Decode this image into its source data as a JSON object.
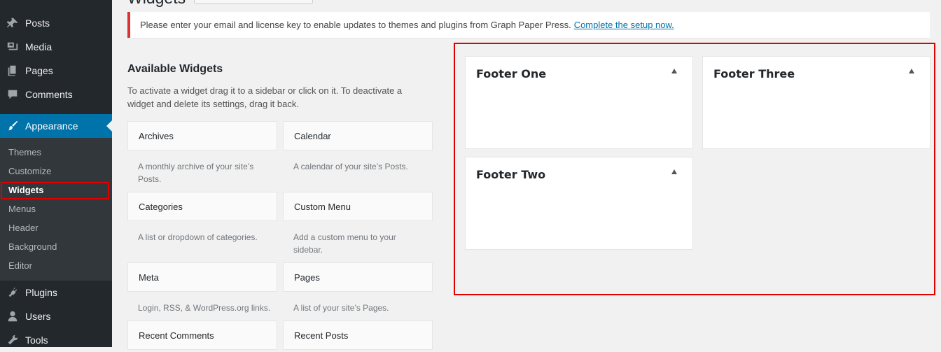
{
  "menu": {
    "items": [
      {
        "key": "posts",
        "label": "Posts",
        "icon": "pin-icon"
      },
      {
        "key": "media",
        "label": "Media",
        "icon": "media-icon"
      },
      {
        "key": "pages",
        "label": "Pages",
        "icon": "pages-icon"
      },
      {
        "key": "comments",
        "label": "Comments",
        "icon": "comment-icon"
      },
      {
        "key": "appearance",
        "label": "Appearance",
        "icon": "paintbrush-icon"
      },
      {
        "key": "plugins",
        "label": "Plugins",
        "icon": "plug-icon"
      },
      {
        "key": "users",
        "label": "Users",
        "icon": "user-icon"
      },
      {
        "key": "tools",
        "label": "Tools",
        "icon": "wrench-icon"
      }
    ],
    "submenu": [
      "Themes",
      "Customize",
      "Widgets",
      "Menus",
      "Header",
      "Background",
      "Editor"
    ],
    "current_sub": "Widgets"
  },
  "page": {
    "title": "Widgets"
  },
  "notice": {
    "text": "Please enter your email and license key to enable updates to themes and plugins from Graph Paper Press.",
    "link": "Complete the setup now."
  },
  "available": {
    "title": "Available Widgets",
    "description": "To activate a widget drag it to a sidebar or click on it. To deactivate a widget and delete its settings, drag it back.",
    "widgets": [
      {
        "name": "Archives",
        "desc": "A monthly archive of your site’s Posts."
      },
      {
        "name": "Calendar",
        "desc": "A calendar of your site’s Posts."
      },
      {
        "name": "Categories",
        "desc": "A list or dropdown of categories."
      },
      {
        "name": "Custom Menu",
        "desc": "Add a custom menu to your sidebar."
      },
      {
        "name": "Meta",
        "desc": "Login, RSS, & WordPress.org links."
      },
      {
        "name": "Pages",
        "desc": "A list of your site’s Pages."
      },
      {
        "name": "Recent Comments",
        "desc": ""
      },
      {
        "name": "Recent Posts",
        "desc": ""
      }
    ]
  },
  "sidebars": [
    {
      "title": "Footer One"
    },
    {
      "title": "Footer Three"
    },
    {
      "title": "Footer Two"
    }
  ],
  "colors": {
    "menu_bg": "#23282d",
    "submenu_bg": "#32373c",
    "accent": "#0073aa",
    "highlight": "#e00000",
    "notice_border": "#dc3232"
  }
}
